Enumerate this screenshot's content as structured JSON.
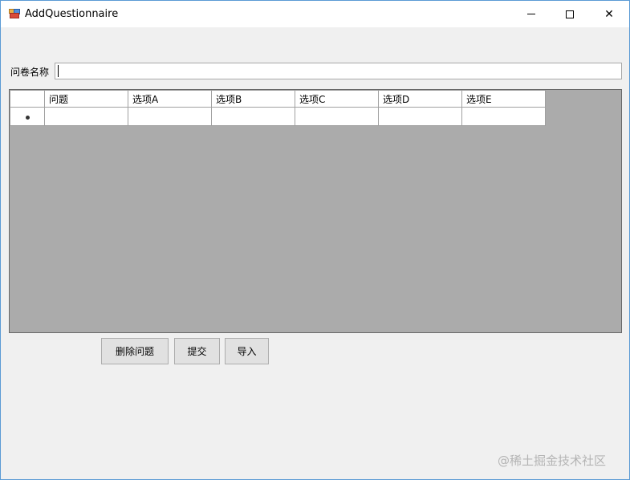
{
  "window": {
    "title": "AddQuestionnaire",
    "controls": {
      "minimize_icon": "minimize-icon",
      "maximize_icon": "maximize-icon",
      "close_glyph": "✕"
    }
  },
  "form": {
    "name_label": "问卷名称",
    "name_value": ""
  },
  "grid": {
    "columns": [
      "问题",
      "选项A",
      "选项B",
      "选项C",
      "选项D",
      "选项E"
    ],
    "new_row_marker": "new-row-marker"
  },
  "buttons": {
    "delete_question": "删除问题",
    "submit": "提交",
    "import": "导入"
  },
  "watermark": "@稀土掘金技术社区",
  "colors": {
    "grid_background": "#ababab",
    "window_border": "#5b9bd5"
  }
}
